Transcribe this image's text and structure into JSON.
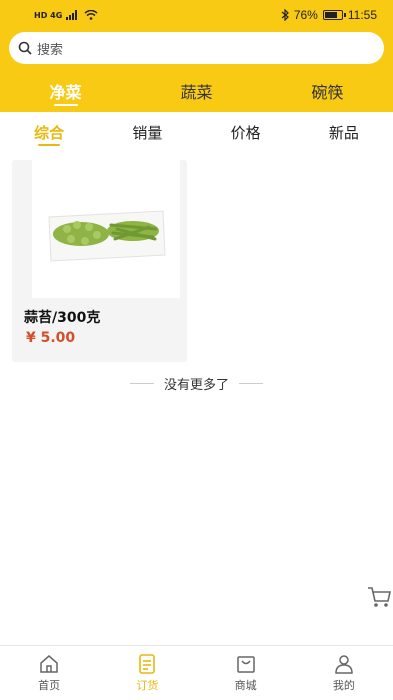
{
  "status_bar": {
    "network_badges": "HD 4G",
    "battery": "76%",
    "time": "11:55",
    "battery_level": 0.76
  },
  "search": {
    "placeholder": "搜索"
  },
  "categories": [
    {
      "label": "净菜",
      "active": true
    },
    {
      "label": "蔬菜",
      "active": false
    },
    {
      "label": "碗筷",
      "active": false
    }
  ],
  "sort_options": [
    {
      "label": "综合",
      "active": true
    },
    {
      "label": "销量",
      "active": false
    },
    {
      "label": "价格",
      "active": false
    },
    {
      "label": "新品",
      "active": false
    }
  ],
  "products": [
    {
      "name": "蒜苔/300克",
      "price": "¥ 5.00"
    }
  ],
  "list_end_text": "没有更多了",
  "tab_bar": [
    {
      "label": "首页",
      "icon": "home-icon",
      "active": false
    },
    {
      "label": "订货",
      "icon": "order-icon",
      "active": true
    },
    {
      "label": "商城",
      "icon": "shop-icon",
      "active": false
    },
    {
      "label": "我的",
      "icon": "user-icon",
      "active": false
    }
  ],
  "colors": {
    "accent": "#f9ca14",
    "accent_text": "#e8b90e",
    "price": "#d24f2a"
  }
}
